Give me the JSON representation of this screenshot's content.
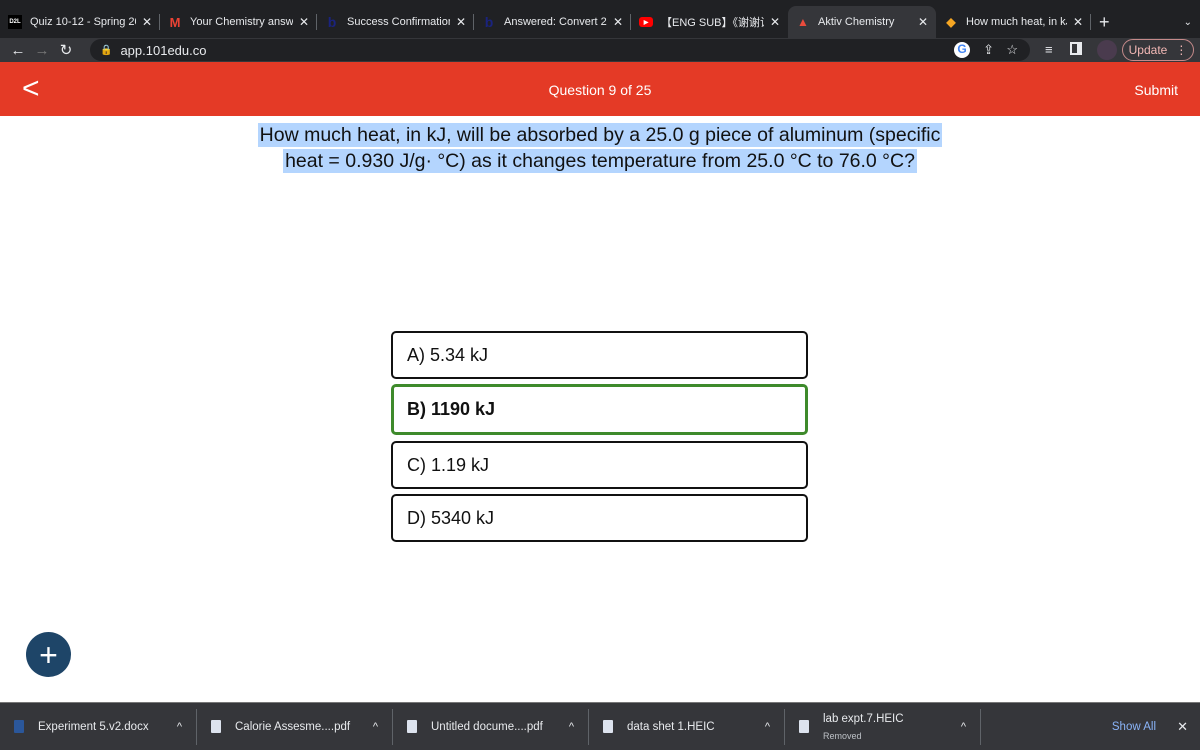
{
  "browser": {
    "tabs": [
      {
        "title": "Quiz 10-12 - Spring 20",
        "icon": "d2l-icon",
        "favicon_text": "D2L"
      },
      {
        "title": "Your Chemistry answe",
        "icon": "gmail-icon",
        "favicon_text": "M"
      },
      {
        "title": "Success Confirmation",
        "icon": "bartleby-icon",
        "favicon_text": "b"
      },
      {
        "title": "Answered: Convert 2",
        "icon": "bartleby-icon",
        "favicon_text": "b"
      },
      {
        "title": "【ENG SUB】《谢谢让",
        "icon": "youtube-icon",
        "favicon_text": "▶"
      },
      {
        "title": "Aktiv Chemistry",
        "icon": "aktiv-icon",
        "favicon_text": "▲",
        "active": true
      },
      {
        "title": "How much heat, in kJ,",
        "icon": "chegg-icon",
        "favicon_text": "◆"
      }
    ],
    "url": "app.101edu.co",
    "update_label": "Update"
  },
  "header": {
    "question_counter": "Question 9 of 25",
    "submit_label": "Submit",
    "color": "#e43a26"
  },
  "question": {
    "line1": "How much heat, in kJ, will be absorbed by a 25.0 g piece of aluminum (specific",
    "line2": "heat = 0.930 J/g· °C) as it changes temperature from 25.0 °C to 76.0 °C?"
  },
  "options": [
    {
      "label": "A) 5.34 kJ",
      "selected": false
    },
    {
      "label": "B) 1190 kJ",
      "selected": true
    },
    {
      "label": "C) 1.19 kJ",
      "selected": false
    },
    {
      "label": "D) 5340 kJ",
      "selected": false
    }
  ],
  "selected_color": "#3e8a2b",
  "downloads": {
    "items": [
      {
        "name": "Experiment 5.v2.docx"
      },
      {
        "name": "Calorie Assesme....pdf"
      },
      {
        "name": "Untitled docume....pdf"
      },
      {
        "name": "data shet 1.HEIC"
      },
      {
        "name": "lab expt.7.HEIC",
        "status": "Removed"
      }
    ],
    "show_all_label": "Show All"
  }
}
